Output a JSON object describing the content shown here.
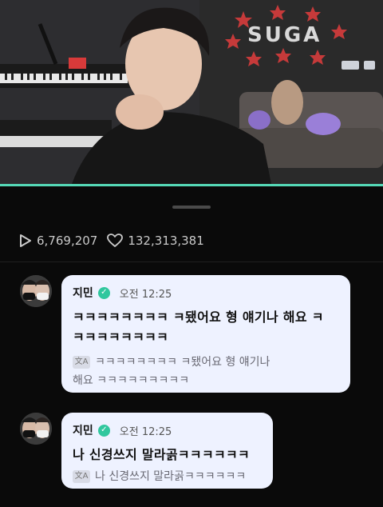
{
  "video": {
    "sign_text": "SUGA"
  },
  "stats": {
    "views": "6,769,207",
    "likes": "132,313,381"
  },
  "comments": [
    {
      "author": "지민",
      "time": "오전 12:25",
      "text_line1": "ㅋㅋㅋㅋㅋㅋㅋㅋ ㅋ됐어요 형 얘기나 해요 ㅋ",
      "text_line2": "ㅋㅋㅋㅋㅋㅋㅋㅋ",
      "translation_line1": "ㅋㅋㅋㅋㅋㅋㅋㅋ ㅋ됐어요 형 얘기나",
      "translation_line2": "해요 ㅋㅋㅋㅋㅋㅋㅋㅋㅋ"
    },
    {
      "author": "지민",
      "time": "오전 12:25",
      "text_line1": "나 신경쓰지 말라곩ㅋㅋㅋㅋㅋㅋ",
      "translation_line1": "나 신경쓰지 말라곩ㅋㅋㅋㅋㅋㅋ"
    }
  ],
  "colors": {
    "accent": "#55d9b7",
    "bubble": "#eef2ff",
    "verified": "#30c79e"
  }
}
